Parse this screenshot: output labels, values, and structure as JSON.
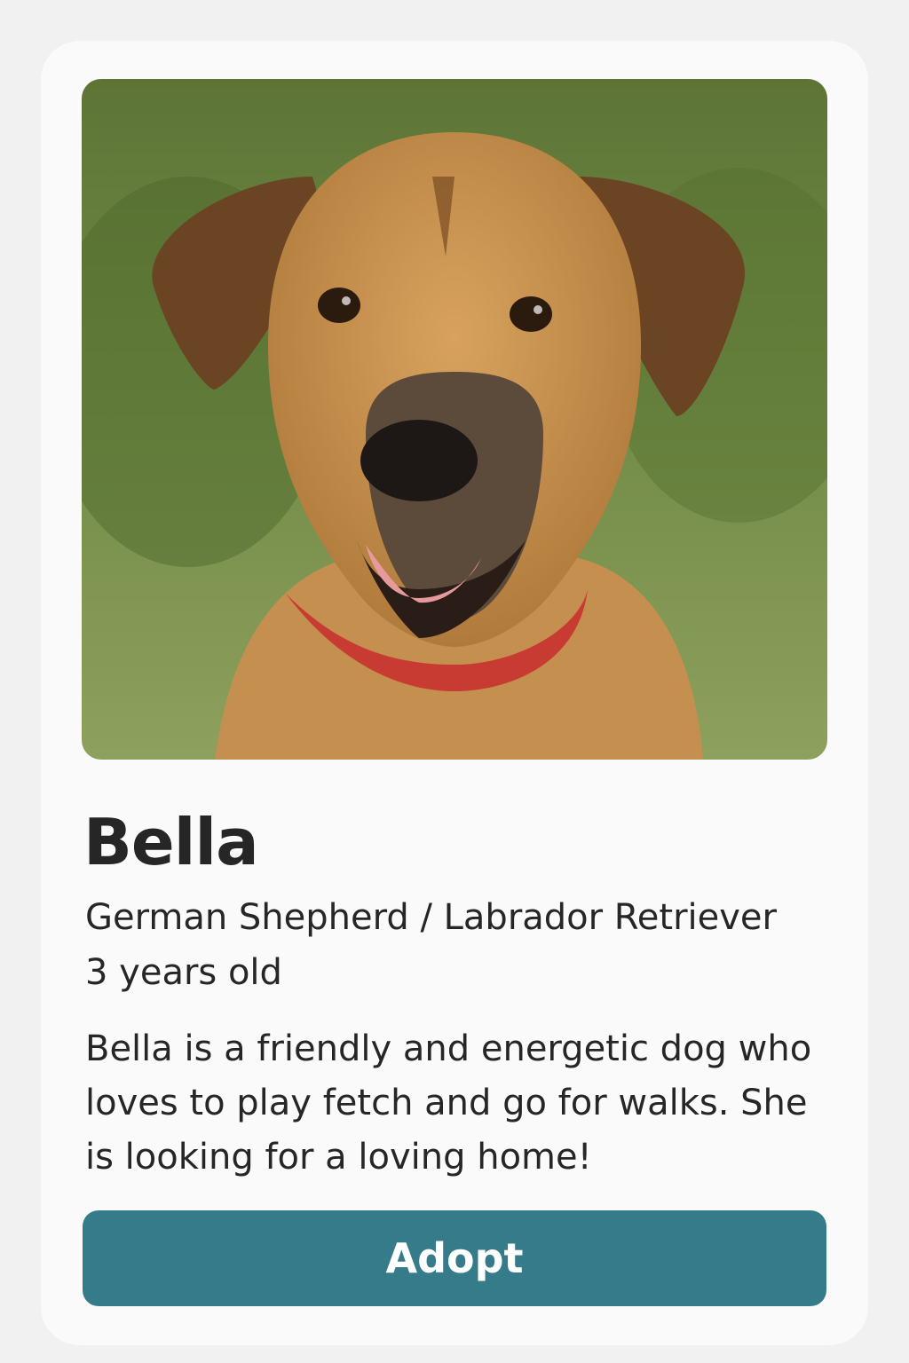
{
  "pet": {
    "name": "Bella",
    "breed": "German Shepherd / Labrador Retriever",
    "age": "3 years old",
    "description": "Bella is a friendly and energetic dog who loves to play fetch and go for walks. She is looking for a loving home!"
  },
  "actions": {
    "adopt_label": "Adopt"
  },
  "colors": {
    "background": "#f1f1f1",
    "card": "#fafafa",
    "text": "#262626",
    "button": "#367b8a",
    "button_text": "#ffffff"
  },
  "photo": {
    "subject": "dog-portrait"
  }
}
